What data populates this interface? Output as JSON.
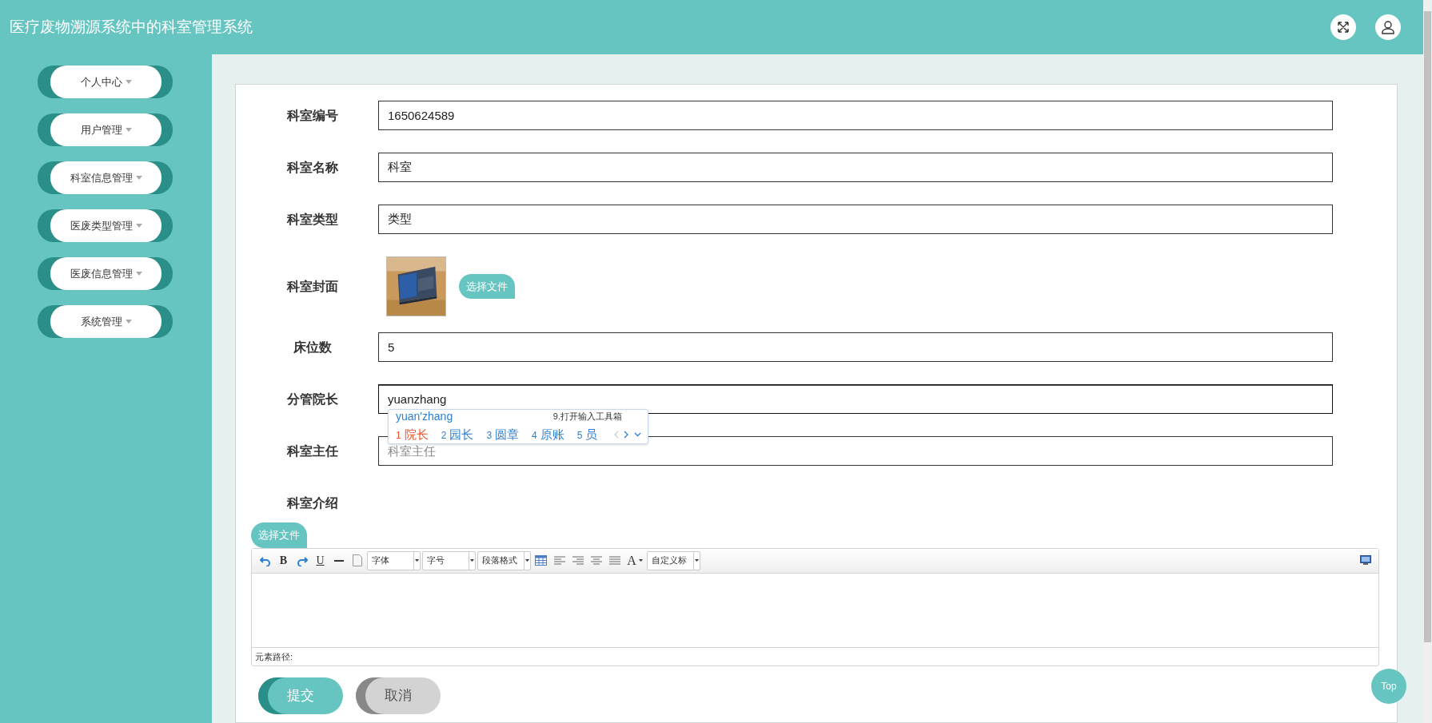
{
  "header": {
    "title": "医疗废物溯源系统中的科室管理系统"
  },
  "sidebar": {
    "items": [
      {
        "label": "个人中心"
      },
      {
        "label": "用户管理"
      },
      {
        "label": "科室信息管理"
      },
      {
        "label": "医废类型管理"
      },
      {
        "label": "医废信息管理"
      },
      {
        "label": "系统管理"
      }
    ]
  },
  "form": {
    "fields": [
      {
        "kind": "text",
        "label": "科室编号",
        "value": "1650624589",
        "focused": false
      },
      {
        "kind": "text",
        "label": "科室名称",
        "value": "科室",
        "focused": false
      },
      {
        "kind": "text",
        "label": "科室类型",
        "value": "类型",
        "focused": false
      },
      {
        "label": "科室封面",
        "button": "选择文件"
      },
      {
        "kind": "text",
        "label": "床位数",
        "value": "5",
        "focused": false
      },
      {
        "kind": "text",
        "label": "分管院长",
        "value": "yuanzhang",
        "focused": true
      },
      {
        "kind": "text",
        "label": "科室主任",
        "placeholder": "科室主任",
        "focused": false
      },
      {
        "kind": "editor",
        "label": "科室介绍",
        "button": "选择文件",
        "path_label": "元素路径:",
        "toolbar": [
          {
            "kind": "undo"
          },
          {
            "kind": "bold",
            "label": "B"
          },
          {
            "kind": "redo"
          },
          {
            "kind": "underline",
            "label": "U"
          },
          {
            "kind": "rule"
          },
          {
            "kind": "page"
          },
          {
            "kind": "select",
            "label": "字体"
          },
          {
            "kind": "select",
            "label": "字号"
          },
          {
            "kind": "select",
            "label": "段落格式"
          },
          {
            "kind": "table"
          },
          {
            "kind": "align-left"
          },
          {
            "kind": "align-right"
          },
          {
            "kind": "align-center"
          },
          {
            "kind": "justify"
          },
          {
            "kind": "font-color",
            "label": "A"
          },
          {
            "kind": "select",
            "label": "自定义标"
          },
          {
            "kind": "fullscreen"
          }
        ]
      }
    ],
    "buttons": [
      {
        "kind": "primary",
        "label": "提交"
      },
      {
        "kind": "secondary",
        "label": "取消"
      }
    ]
  },
  "ime": {
    "composition": "yuan'zhang",
    "toolbox": "9.打开输入工具箱",
    "candidates": [
      {
        "number": "1",
        "text": "院长",
        "selected": true
      },
      {
        "number": "2",
        "text": "园长",
        "selected": false
      },
      {
        "number": "3",
        "text": "圆章",
        "selected": false
      },
      {
        "number": "4",
        "text": "原账",
        "selected": false
      },
      {
        "number": "5",
        "text": "员",
        "selected": false
      }
    ]
  },
  "top_button": "Top"
}
